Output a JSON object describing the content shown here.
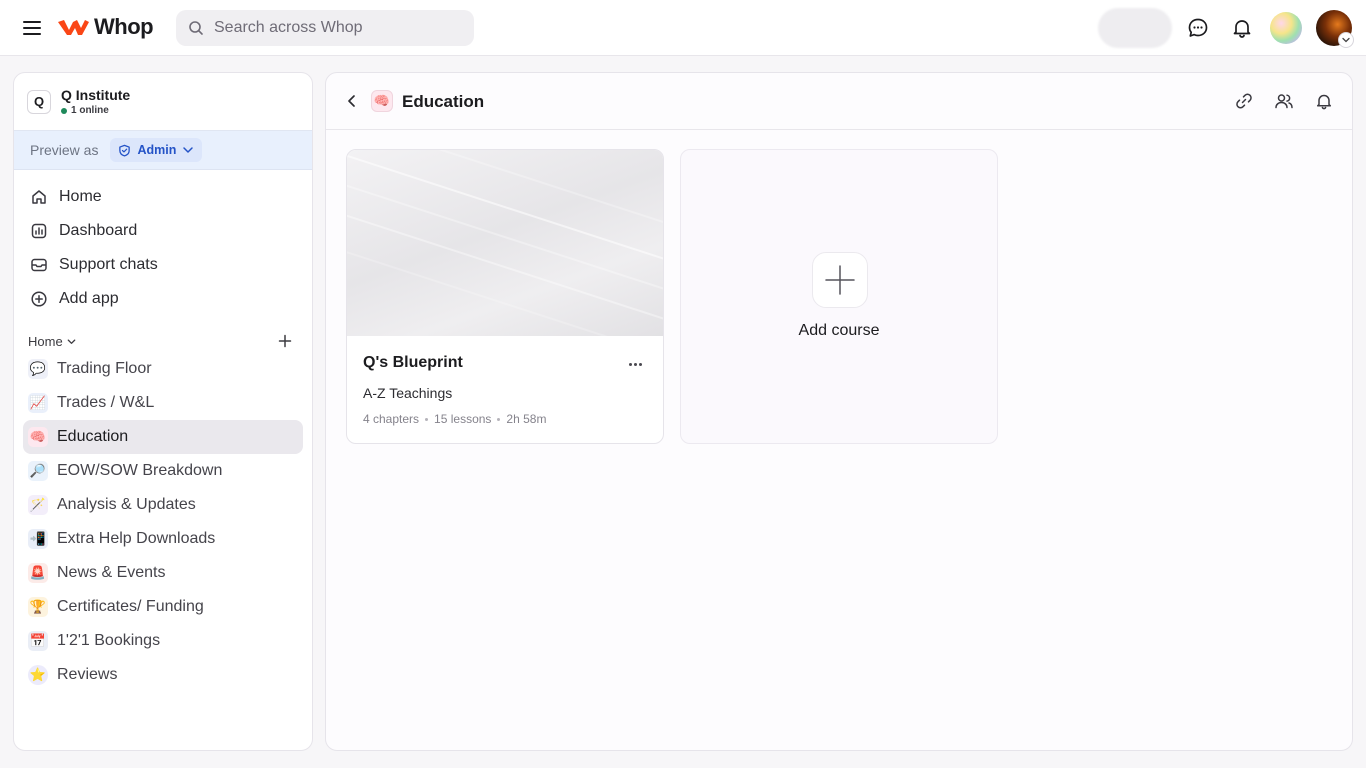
{
  "topbar": {
    "brand": "Whop",
    "search_placeholder": "Search across Whop"
  },
  "community": {
    "initial": "Q",
    "name": "Q Institute",
    "online": "1 online"
  },
  "preview": {
    "label": "Preview as",
    "role": "Admin"
  },
  "nav": [
    {
      "label": "Home",
      "icon": "home-icon"
    },
    {
      "label": "Dashboard",
      "icon": "dashboard-icon"
    },
    {
      "label": "Support chats",
      "icon": "inbox-icon"
    },
    {
      "label": "Add app",
      "icon": "plus-circle-icon"
    }
  ],
  "section": {
    "label": "Home"
  },
  "channels": [
    {
      "label": "Trading Floor",
      "emoji": "💬",
      "active": false
    },
    {
      "label": "Trades / W&L",
      "emoji": "📈",
      "active": false
    },
    {
      "label": "Education",
      "emoji": "🧠",
      "active": true
    },
    {
      "label": "EOW/SOW Breakdown",
      "emoji": "🔎",
      "active": false
    },
    {
      "label": "Analysis & Updates",
      "emoji": "🪄",
      "active": false
    },
    {
      "label": "Extra Help Downloads",
      "emoji": "📲",
      "active": false
    },
    {
      "label": "News & Events",
      "emoji": "🚨",
      "active": false
    },
    {
      "label": "Certificates/ Funding",
      "emoji": "🏆",
      "active": false
    },
    {
      "label": "1'2'1 Bookings",
      "emoji": "📅",
      "active": false
    },
    {
      "label": "Reviews",
      "emoji": "⭐",
      "active": false
    }
  ],
  "main": {
    "title": "Education",
    "title_emoji": "🧠"
  },
  "course": {
    "title": "Q's Blueprint",
    "subtitle": "A-Z Teachings",
    "chapters": "4 chapters",
    "lessons": "15 lessons",
    "duration": "2h 58m"
  },
  "add_course": {
    "label": "Add course"
  },
  "colors": {
    "brand": "#fa4616",
    "active_bg": "#eae8ed",
    "preview_bg": "#e8f0fd",
    "admin_badge": "#2453c7",
    "online": "#1f8a5b"
  }
}
